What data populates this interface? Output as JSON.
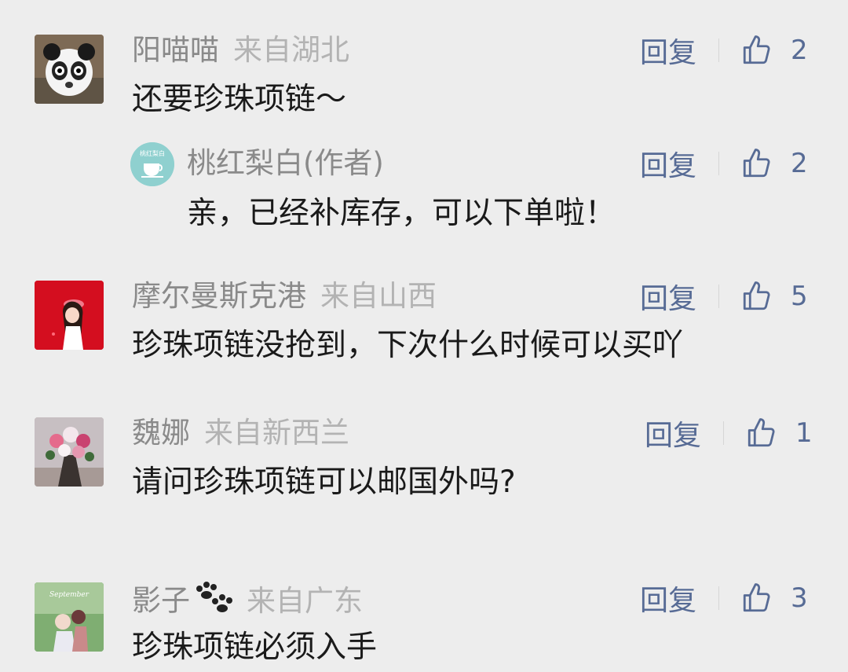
{
  "colors": {
    "background": "#ededed",
    "link": "#576b95",
    "name": "#8a8a8a",
    "location": "#b3b3b3",
    "text": "#1a1a1a"
  },
  "comments": [
    {
      "name": "阳喵喵",
      "location": "来自湖北",
      "text": "还要珍珠项链～",
      "reply_label": "回复",
      "likes": "2",
      "avatar_icon": "panda-avatar",
      "reply": {
        "name": "桃红梨白(作者)",
        "text": "亲，已经补库存，可以下单啦！",
        "reply_label": "回复",
        "likes": "2",
        "avatar_icon": "teacup-avatar",
        "avatar_text": "桃红梨白"
      }
    },
    {
      "name": "摩尔曼斯克港",
      "location": "来自山西",
      "text": "珍珠项链没抢到，下次什么时候可以买吖",
      "reply_label": "回复",
      "likes": "5",
      "avatar_icon": "girl-avatar"
    },
    {
      "name": "魏娜",
      "location": "来自新西兰",
      "text": "请问珍珠项链可以邮国外吗?",
      "reply_label": "回复",
      "likes": "1",
      "avatar_icon": "flowers-avatar"
    },
    {
      "name": "影子",
      "location": "来自广东",
      "text": "珍珠项链必须入手",
      "reply_label": "回复",
      "likes": "3",
      "avatar_icon": "photo-avatar",
      "avatar_text": "September",
      "name_emoji": "paw-prints-icon"
    }
  ]
}
